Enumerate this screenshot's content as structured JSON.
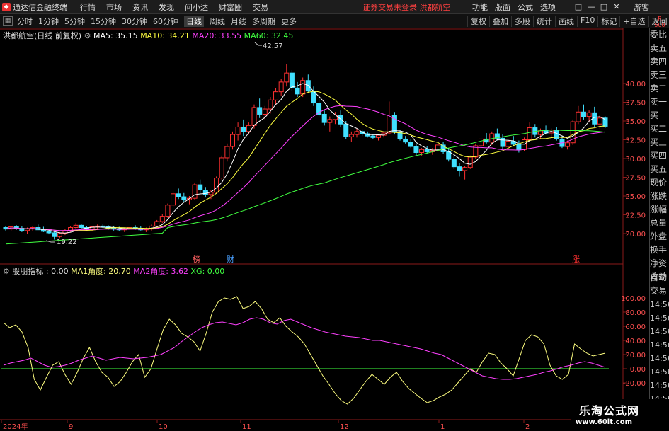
{
  "titlebar": {
    "app_title": "通达信金融终端",
    "menu": [
      "行情",
      "市场",
      "资讯",
      "发现",
      "问小达",
      "财富圈",
      "交易"
    ],
    "notice": "证券交易未登录  洪都航空",
    "right_menu": [
      "功能",
      "版面",
      "公式",
      "选项"
    ],
    "window_controls": [
      "□",
      "—",
      "□",
      "✕"
    ],
    "guest": "游客"
  },
  "toolbar": {
    "periods": [
      "分时",
      "1分钟",
      "5分钟",
      "15分钟",
      "30分钟",
      "60分钟",
      "日线",
      "周线",
      "月线",
      "多周期",
      "更多"
    ],
    "active_period": "日线",
    "right": [
      "复权",
      "叠加",
      "多股",
      "统计",
      "画线",
      "F10",
      "标记",
      "+自选",
      "返回"
    ]
  },
  "main_chart": {
    "stock": "洪都航空(日线 前复权)",
    "ma": [
      {
        "label": "MA5: 35.15",
        "color": "#ffffff"
      },
      {
        "label": "MA10: 34.21",
        "color": "#ffff40"
      },
      {
        "label": "MA20: 33.55",
        "color": "#ff40ff"
      },
      {
        "label": "MA60: 32.45",
        "color": "#40ff40"
      }
    ],
    "y_ticks": [
      "40.00",
      "37.50",
      "35.00",
      "32.50",
      "30.00",
      "27.50",
      "25.00",
      "22.50",
      "20.00"
    ],
    "high_label": "42.57",
    "low_label": "19.22",
    "markers": [
      {
        "text": "榜",
        "color": "#ff6060"
      },
      {
        "text": "财",
        "color": "#4aa0ff"
      },
      {
        "text": "涨",
        "color": "#ff3030"
      }
    ]
  },
  "indicator": {
    "name": "股朋指标",
    "value": ": 0.00",
    "items": [
      {
        "label": "MA1角度: 20.70",
        "color": "#ffff80"
      },
      {
        "label": "MA2角度: 3.62",
        "color": "#ff40ff"
      },
      {
        "label": "XG: 0.00",
        "color": "#40ff40"
      }
    ],
    "y_ticks": [
      "100.00",
      "80.00",
      "60.00",
      "40.00",
      "20.00",
      "0.00",
      "-20.00"
    ]
  },
  "x_axis": [
    "2024年",
    "9",
    "10",
    "11",
    "12",
    "1",
    "2"
  ],
  "sidebar": {
    "top_badge": [
      "R",
      "500"
    ],
    "items": [
      "委比",
      "卖五",
      "卖四",
      "卖三",
      "卖二",
      "卖一",
      "买一",
      "买二",
      "买三",
      "买四",
      "买五",
      "现价",
      "涨跌",
      "涨幅",
      "总量",
      "外盘",
      "换手",
      "净资",
      "收益"
    ],
    "lower_items": [
      "自动",
      "交易"
    ],
    "times": [
      "14:56",
      "14:56",
      "14:56",
      "14:56",
      "14:56",
      "14:56",
      "14:56",
      "14:56"
    ]
  },
  "watermark": {
    "line1": "乐淘公式网",
    "line2": "www.60lt.com"
  },
  "chart_data": [
    {
      "type": "candlestick",
      "title": "洪都航空(日线 前复权)",
      "ylim": [
        17.5,
        42.5
      ],
      "x_labels": [
        "2024年",
        "9",
        "10",
        "11",
        "12",
        "1",
        "2"
      ],
      "ohlc": [
        [
          20.8,
          21.0,
          20.4,
          20.6
        ],
        [
          20.6,
          21.0,
          20.3,
          20.9
        ],
        [
          20.9,
          21.1,
          20.5,
          20.7
        ],
        [
          20.7,
          21.0,
          20.2,
          20.4
        ],
        [
          20.4,
          20.8,
          20.0,
          20.6
        ],
        [
          20.6,
          21.0,
          20.3,
          20.8
        ],
        [
          20.8,
          21.2,
          20.5,
          20.5
        ],
        [
          20.5,
          20.9,
          20.2,
          20.3
        ],
        [
          20.3,
          20.6,
          19.9,
          20.1
        ],
        [
          20.1,
          20.4,
          19.2,
          19.6
        ],
        [
          19.6,
          20.2,
          19.4,
          20.0
        ],
        [
          20.0,
          20.6,
          19.8,
          20.4
        ],
        [
          20.4,
          21.0,
          20.2,
          20.8
        ],
        [
          20.8,
          21.4,
          20.6,
          21.1
        ],
        [
          21.1,
          21.3,
          20.6,
          20.8
        ],
        [
          20.8,
          21.0,
          20.4,
          20.6
        ],
        [
          20.6,
          21.0,
          20.3,
          20.9
        ],
        [
          20.9,
          21.2,
          20.6,
          21.0
        ],
        [
          21.0,
          21.3,
          20.7,
          20.9
        ],
        [
          20.9,
          21.1,
          20.5,
          20.7
        ],
        [
          20.7,
          21.0,
          20.4,
          20.6
        ],
        [
          20.6,
          20.9,
          20.3,
          20.5
        ],
        [
          20.5,
          20.8,
          20.2,
          20.6
        ],
        [
          20.6,
          20.9,
          20.3,
          20.8
        ],
        [
          20.8,
          21.1,
          20.5,
          20.7
        ],
        [
          20.7,
          21.0,
          20.4,
          20.5
        ],
        [
          20.5,
          20.8,
          20.2,
          20.6
        ],
        [
          20.6,
          21.2,
          20.4,
          21.0
        ],
        [
          21.0,
          21.8,
          20.8,
          21.6
        ],
        [
          21.6,
          22.6,
          21.4,
          22.3
        ],
        [
          22.3,
          24.0,
          22.1,
          23.8
        ],
        [
          23.8,
          25.6,
          23.6,
          25.3
        ],
        [
          25.3,
          26.0,
          24.6,
          24.9
        ],
        [
          24.9,
          25.4,
          24.2,
          24.5
        ],
        [
          24.5,
          25.0,
          23.9,
          24.7
        ],
        [
          24.7,
          26.8,
          24.5,
          26.5
        ],
        [
          26.5,
          27.2,
          25.4,
          25.8
        ],
        [
          25.8,
          26.2,
          24.8,
          25.2
        ],
        [
          25.2,
          25.8,
          24.6,
          25.5
        ],
        [
          25.5,
          27.6,
          25.3,
          27.4
        ],
        [
          27.4,
          30.4,
          27.2,
          30.1
        ],
        [
          30.1,
          32.0,
          29.6,
          31.6
        ],
        [
          31.6,
          33.6,
          31.2,
          33.2
        ],
        [
          33.2,
          34.8,
          32.4,
          34.2
        ],
        [
          34.2,
          35.2,
          33.0,
          33.6
        ],
        [
          33.6,
          34.8,
          33.2,
          34.4
        ],
        [
          34.4,
          37.2,
          34.0,
          36.8
        ],
        [
          36.8,
          38.0,
          35.4,
          35.9
        ],
        [
          35.9,
          37.0,
          35.2,
          36.6
        ],
        [
          36.6,
          38.2,
          36.0,
          37.8
        ],
        [
          37.8,
          39.4,
          37.2,
          38.9
        ],
        [
          38.9,
          40.6,
          38.4,
          40.2
        ],
        [
          40.2,
          42.57,
          39.6,
          41.4
        ],
        [
          41.4,
          41.8,
          39.0,
          39.4
        ],
        [
          39.4,
          40.2,
          38.2,
          38.6
        ],
        [
          38.6,
          40.8,
          38.2,
          40.4
        ],
        [
          40.4,
          41.2,
          38.8,
          39.0
        ],
        [
          39.0,
          39.6,
          37.0,
          37.4
        ],
        [
          37.4,
          38.0,
          35.6,
          35.9
        ],
        [
          35.9,
          36.4,
          34.4,
          34.8
        ],
        [
          34.8,
          35.6,
          33.6,
          35.2
        ],
        [
          35.2,
          36.2,
          34.6,
          35.8
        ],
        [
          35.8,
          36.4,
          34.2,
          34.6
        ],
        [
          34.6,
          35.0,
          32.6,
          32.9
        ],
        [
          32.9,
          33.6,
          32.2,
          33.2
        ],
        [
          33.2,
          34.0,
          32.8,
          33.6
        ],
        [
          33.6,
          33.9,
          33.0,
          33.3
        ],
        [
          33.3,
          33.6,
          32.8,
          33.0
        ],
        [
          33.0,
          33.3,
          32.6,
          32.8
        ],
        [
          32.8,
          33.2,
          32.4,
          33.1
        ],
        [
          33.1,
          33.5,
          32.8,
          33.4
        ],
        [
          33.4,
          37.6,
          33.2,
          35.8
        ],
        [
          35.8,
          36.2,
          33.2,
          33.5
        ],
        [
          33.5,
          33.8,
          32.4,
          32.6
        ],
        [
          32.6,
          33.0,
          32.0,
          32.2
        ],
        [
          32.2,
          32.6,
          31.4,
          31.6
        ],
        [
          31.6,
          32.0,
          30.4,
          30.8
        ],
        [
          30.8,
          31.4,
          30.4,
          31.2
        ],
        [
          31.2,
          31.6,
          30.6,
          30.9
        ],
        [
          30.9,
          31.4,
          30.5,
          31.1
        ],
        [
          31.1,
          32.0,
          30.9,
          31.8
        ],
        [
          31.8,
          32.2,
          30.6,
          30.9
        ],
        [
          30.9,
          31.4,
          29.6,
          29.9
        ],
        [
          29.9,
          30.6,
          28.6,
          28.9
        ],
        [
          28.9,
          29.4,
          27.6,
          28.4
        ],
        [
          28.4,
          29.0,
          27.2,
          28.8
        ],
        [
          28.8,
          30.4,
          28.6,
          30.2
        ],
        [
          30.2,
          32.0,
          30.0,
          31.7
        ],
        [
          31.7,
          33.0,
          31.4,
          32.6
        ],
        [
          32.6,
          33.4,
          32.0,
          32.2
        ],
        [
          32.2,
          33.6,
          31.8,
          33.3
        ],
        [
          33.3,
          34.0,
          32.4,
          32.7
        ],
        [
          32.7,
          33.2,
          31.2,
          31.6
        ],
        [
          31.6,
          32.6,
          31.2,
          32.3
        ],
        [
          32.3,
          33.0,
          31.6,
          31.9
        ],
        [
          31.9,
          32.4,
          30.8,
          31.2
        ],
        [
          31.2,
          32.8,
          31.0,
          32.5
        ],
        [
          32.5,
          34.8,
          32.2,
          34.1
        ],
        [
          34.1,
          34.6,
          32.8,
          33.2
        ],
        [
          33.2,
          34.0,
          32.6,
          33.7
        ],
        [
          33.7,
          34.4,
          33.2,
          33.4
        ],
        [
          33.4,
          34.0,
          32.8,
          33.8
        ],
        [
          33.8,
          34.2,
          32.4,
          32.6
        ],
        [
          32.6,
          33.0,
          31.4,
          31.6
        ],
        [
          31.6,
          32.4,
          31.2,
          32.1
        ],
        [
          32.1,
          35.2,
          31.8,
          34.9
        ],
        [
          34.9,
          37.0,
          34.6,
          36.2
        ],
        [
          36.2,
          37.2,
          35.2,
          35.6
        ],
        [
          35.6,
          36.4,
          34.8,
          36.1
        ],
        [
          36.1,
          36.9,
          34.2,
          34.6
        ],
        [
          34.6,
          35.8,
          34.0,
          35.4
        ],
        [
          35.4,
          35.6,
          34.1,
          34.3
        ]
      ]
    },
    {
      "type": "line",
      "title": "股朋指标",
      "ylim": [
        -30,
        110
      ],
      "series": [
        {
          "name": "MA1角度",
          "values": [
            65,
            58,
            62,
            52,
            30,
            -15,
            -30,
            -12,
            5,
            10,
            -8,
            -22,
            -5,
            15,
            30,
            10,
            -5,
            -12,
            -25,
            -18,
            -5,
            10,
            20,
            -12,
            0,
            28,
            55,
            70,
            62,
            50,
            45,
            38,
            25,
            50,
            80,
            95,
            100,
            98,
            102,
            85,
            88,
            95,
            85,
            70,
            65,
            72,
            60,
            52,
            45,
            35,
            20,
            5,
            -10,
            -22,
            -35,
            -45,
            -50,
            -42,
            -30,
            -18,
            -8,
            -15,
            -22,
            -12,
            -5,
            -18,
            -28,
            -35,
            -42,
            -48,
            -45,
            -40,
            -36,
            -30,
            -20,
            -10,
            0,
            -5,
            10,
            22,
            20,
            8,
            0,
            -10,
            15,
            40,
            48,
            45,
            35,
            5,
            -10,
            -15,
            -8,
            35,
            28,
            22,
            18,
            20,
            22
          ]
        },
        {
          "name": "MA2角度",
          "values": [
            5,
            8,
            10,
            12,
            15,
            10,
            5,
            2,
            3,
            5,
            8,
            12,
            15,
            18,
            15,
            12,
            14,
            16,
            15,
            14,
            15,
            16,
            18,
            20,
            25,
            30,
            38,
            45,
            52,
            58,
            62,
            65,
            66,
            64,
            62,
            65,
            70,
            72,
            70,
            65,
            63,
            68,
            70,
            66,
            62,
            58,
            55,
            52,
            50,
            48,
            46,
            45,
            44,
            42,
            40,
            40,
            38,
            36,
            34,
            32,
            30,
            28,
            25,
            22,
            20,
            15,
            10,
            5,
            0,
            -5,
            -10,
            -12,
            -14,
            -15,
            -15,
            -14,
            -12,
            -10,
            -8,
            -5,
            -3,
            0,
            3,
            5,
            8,
            10,
            8,
            5,
            2
          ]
        },
        {
          "name": "XG",
          "values": [
            0,
            0
          ]
        }
      ]
    }
  ]
}
